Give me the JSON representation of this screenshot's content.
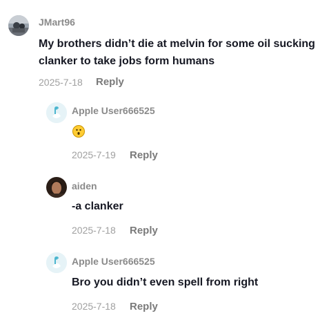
{
  "comments": [
    {
      "username": "JMart96",
      "text": "My brothers didn’t die at melvin for some oil sucking clanker to take jobs form humans",
      "date": "2025-7-18",
      "reply_label": "Reply",
      "avatar_icon": "user-photo-avatar"
    },
    {
      "username": "Apple User666525",
      "text_icon": "astonished-face-emoji",
      "date": "2025-7-19",
      "reply_label": "Reply",
      "avatar_icon": "default-tiktok-avatar"
    },
    {
      "username": "aiden",
      "text": "-a clanker",
      "date": "2025-7-18",
      "reply_label": "Reply",
      "avatar_icon": "user-photo-avatar"
    },
    {
      "username": "Apple User666525",
      "text": "Bro you didn’t even spell from right",
      "date": "2025-7-18",
      "reply_label": "Reply",
      "avatar_icon": "default-tiktok-avatar"
    }
  ],
  "colors": {
    "text": "#161823",
    "username": "#8a8a8a",
    "meta": "#a0a0a0",
    "default_avatar_bg": "#e6f3f7"
  }
}
